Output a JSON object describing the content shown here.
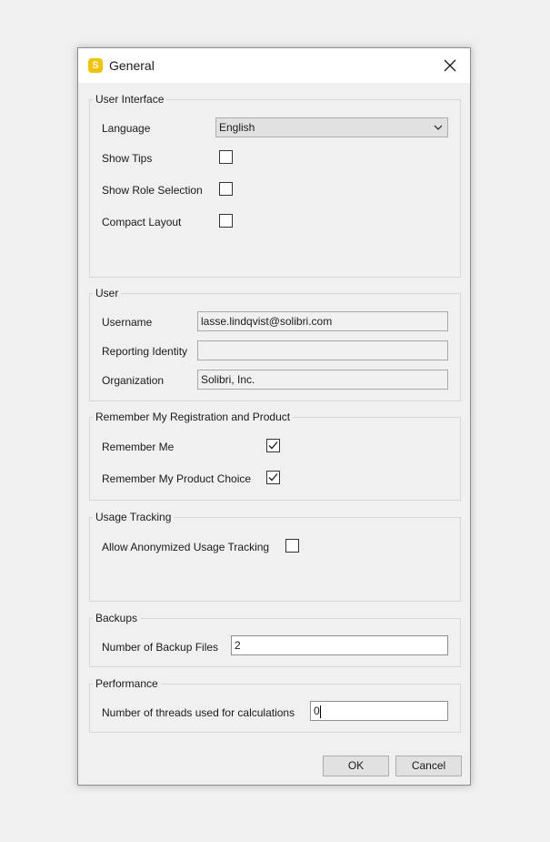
{
  "window": {
    "title": "General",
    "app_icon_letter": "S",
    "app_icon_color": "#f5c400"
  },
  "user_interface": {
    "legend": "User Interface",
    "language_label": "Language",
    "language_value": "English",
    "show_tips_label": "Show Tips",
    "show_tips_checked": false,
    "show_role_selection_label": "Show Role Selection",
    "show_role_selection_checked": false,
    "compact_layout_label": "Compact Layout",
    "compact_layout_checked": false
  },
  "user": {
    "legend": "User",
    "username_label": "Username",
    "username_value": "lasse.lindqvist@solibri.com",
    "reporting_identity_label": "Reporting Identity",
    "reporting_identity_value": "",
    "organization_label": "Organization",
    "organization_value": "Solibri, Inc."
  },
  "registration": {
    "legend": "Remember My Registration and Product",
    "remember_me_label": "Remember Me",
    "remember_me_checked": true,
    "remember_product_label": "Remember My Product Choice",
    "remember_product_checked": true
  },
  "usage_tracking": {
    "legend": "Usage Tracking",
    "allow_label": "Allow Anonymized Usage Tracking",
    "allow_checked": false
  },
  "backups": {
    "legend": "Backups",
    "count_label": "Number of Backup Files",
    "count_value": "2"
  },
  "performance": {
    "legend": "Performance",
    "threads_label": "Number of threads used for calculations",
    "threads_value": "0"
  },
  "buttons": {
    "ok_label": "OK",
    "cancel_label": "Cancel"
  },
  "icons": {
    "close": "close-icon",
    "dropdown": "chevron-down-icon",
    "check": "checkmark-icon"
  }
}
